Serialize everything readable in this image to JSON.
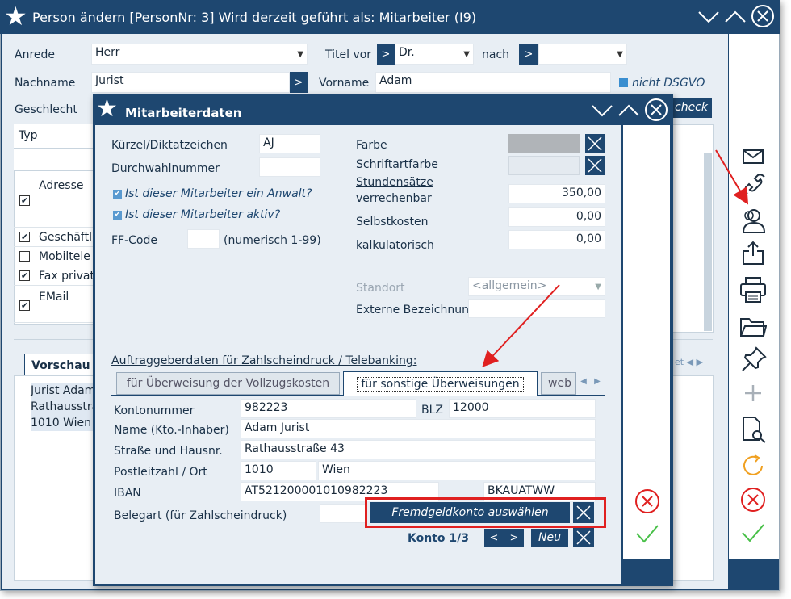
{
  "outer": {
    "title": "Person ändern  [PersonNr: 3] Wird derzeit geführt als: Mitarbeiter (I9)",
    "anrede_label": "Anrede",
    "anrede_value": "Herr",
    "titel_vor_label": "Titel vor",
    "titel_vor_value": "Dr.",
    "nach_label": "nach",
    "nach_value": "",
    "nachname_label": "Nachname",
    "nachname_value": "Jurist",
    "vorname_label": "Vorname",
    "vorname_value": "Adam",
    "dsgvo_label": "nicht DSGVO",
    "geschlecht_label": "Geschlecht",
    "check_label": "check",
    "typ_header": "Typ",
    "rows": [
      "Adresse",
      "Geschäftli",
      "Mobiltele",
      "Fax privat",
      "EMail"
    ],
    "vorschau_tab": "Vorschau",
    "preview_lines": [
      "Jurist Adam",
      "Rathausstra",
      "1010 Wien"
    ]
  },
  "dialog": {
    "title": "Mitarbeiterdaten",
    "kuerzel_label": "Kürzel/Diktatzeichen",
    "kuerzel_value": "AJ",
    "durchwahl_label": "Durchwahlnummer",
    "durchwahl_value": "",
    "anwalt_label": "Ist dieser Mitarbeiter ein Anwalt?",
    "aktiv_label": "Ist dieser Mitarbeiter aktiv?",
    "ffcode_label": "FF-Code",
    "ffcode_value": "",
    "ffcode_hint": "(numerisch 1-99)",
    "farbe_label": "Farbe",
    "schriftfarbe_label": "Schriftartfarbe",
    "stundensaetze_label": "Stundensätze",
    "verrechenbar_label": "verrechenbar",
    "verrechenbar_value": "350,00",
    "selbstkosten_label": "Selbstkosten",
    "selbstkosten_value": "0,00",
    "kalkulatorisch_label": "kalkulatorisch",
    "kalkulatorisch_value": "0,00",
    "standort_label": "Standort",
    "standort_value": "<allgemein>",
    "extern_label": "Externe Bezeichnung",
    "extern_value": "",
    "auftrag_header": "Auftraggeberdaten für Zahlscheindruck / Telebanking:",
    "tabs": [
      "für Überweisung der Vollzugskosten",
      "für sonstige Überweisungen",
      "web"
    ],
    "konto_label": "Kontonummer",
    "konto_value": "982223",
    "blz_label": "BLZ",
    "blz_value": "12000",
    "name_label": "Name (Kto.-Inhaber)",
    "name_value": "Adam Jurist",
    "strasse_label": "Straße und Hausnr.",
    "strasse_value": "Rathausstraße 43",
    "plz_label": "Postleitzahl / Ort",
    "plz_value": "1010",
    "ort_value": "Wien",
    "iban_label": "IBAN",
    "iban_value": "AT521200001010982223",
    "bic_value": "BKAUATWW",
    "belegart_label": "Belegart (für Zahlscheindruck)",
    "fremdgeld_label": "Fremdgeldkonto auswählen",
    "konto_counter": "Konto 1/3",
    "prev_label": "<",
    "next_label": ">",
    "neu_label": "Neu"
  },
  "sidebar_icons": [
    "mail-icon",
    "phone-icon",
    "person-icon",
    "share-icon",
    "print-icon",
    "folder-icon",
    "pin-icon",
    "plus-icon",
    "document-search-icon",
    "refresh-icon",
    "cancel-icon",
    "confirm-icon"
  ],
  "colors": {
    "navy": "#1e4770",
    "red": "#e02020",
    "green": "#48c048",
    "orange": "#f0a020"
  }
}
